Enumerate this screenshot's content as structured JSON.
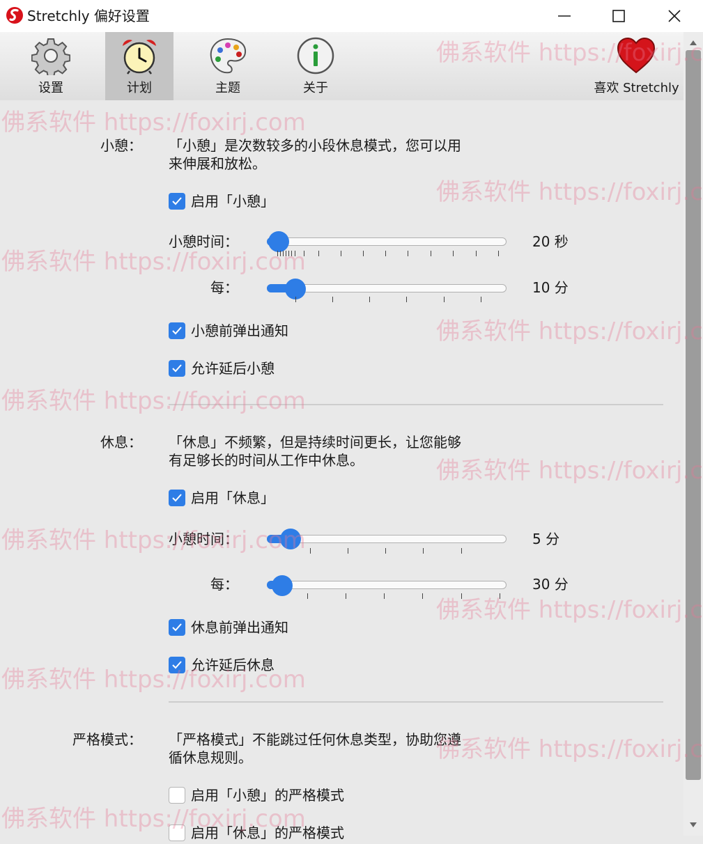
{
  "window": {
    "title": "Stretchly 偏好设置",
    "logo_icon": "stretchly-logo-icon",
    "minimize_icon": "minimize-icon",
    "maximize_icon": "maximize-icon",
    "close_icon": "close-icon"
  },
  "toolbar": {
    "items": [
      {
        "label": "设置",
        "icon": "gear-icon",
        "active": false
      },
      {
        "label": "计划",
        "icon": "alarm-clock-icon",
        "active": true
      },
      {
        "label": "主题",
        "icon": "palette-icon",
        "active": false
      },
      {
        "label": "关于",
        "icon": "info-icon",
        "active": false
      }
    ],
    "like": {
      "label": "喜欢 Stretchly",
      "icon": "heart-icon"
    }
  },
  "mini_break": {
    "label": "小憩：",
    "description_line1": "「小憩」是次数较多的小段休息模式，您可以用",
    "description_line2": "来伸展和放松。",
    "enable": {
      "label": "启用「小憩」",
      "checked": true
    },
    "duration": {
      "label": "小憩时间：",
      "value": "20 秒",
      "level": 0.05
    },
    "interval": {
      "label": "每：",
      "value": "10 分",
      "level": 0.12
    },
    "notify": {
      "label": "小憩前弹出通知",
      "checked": true
    },
    "postpone": {
      "label": "允许延后小憩",
      "checked": true
    }
  },
  "long_break": {
    "label": "休息：",
    "description_line1": "「休息」不频繁，但是持续时间更长，让您能够",
    "description_line2": "有足够长的时间从工作中休息。",
    "enable": {
      "label": "启用「休息」",
      "checked": true
    },
    "duration": {
      "label": "小憩时间：",
      "value": "5 分",
      "level": 0.1
    },
    "interval": {
      "label": "每：",
      "value": "30 分",
      "level": 0.06
    },
    "notify": {
      "label": "休息前弹出通知",
      "checked": true
    },
    "postpone": {
      "label": "允许延后休息",
      "checked": true
    }
  },
  "strict_mode": {
    "label": "严格模式：",
    "description_line1": "「严格模式」不能跳过任何休息类型，协助您遵",
    "description_line2": "循休息规则。",
    "mini": {
      "label": "启用「小憩」的严格模式",
      "checked": false
    },
    "long": {
      "label": "启用「休息」的严格模式",
      "checked": false
    }
  },
  "watermark": {
    "text": "佛系软件 https://foxirj.com"
  },
  "colors": {
    "accent": "#2e7de6",
    "active_tab": "#c4c4c4",
    "heart": "#d4141b"
  }
}
